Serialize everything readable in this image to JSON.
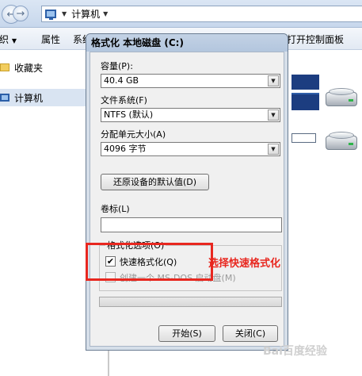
{
  "explorer": {
    "address_text": "计算机",
    "toolbar": {
      "organize_label": "织",
      "properties_label": "属性",
      "system_label": "系统",
      "control_panel_label": "打开控制面板"
    },
    "sidebar": {
      "items": [
        {
          "label": "收藏夹",
          "icon": "folder-star-icon"
        },
        {
          "label": "计算机",
          "icon": "computer-icon"
        }
      ]
    }
  },
  "dialog": {
    "title": "格式化 本地磁盘 (C:)",
    "capacity_label": "容量(P):",
    "capacity_value": "40.4 GB",
    "filesystem_label": "文件系统(F)",
    "filesystem_value": "NTFS (默认)",
    "allocation_label": "分配单元大小(A)",
    "allocation_value": "4096 字节",
    "restore_defaults_label": "还原设备的默认值(D)",
    "volume_label_label": "卷标(L)",
    "volume_label_value": "",
    "format_options_label": "格式化选项(O)",
    "quick_format_label": "快速格式化(Q)",
    "quick_format_checked": true,
    "msdos_label": "创建一个 MS-DOS 启动盘(M)",
    "msdos_checked": false,
    "progress": 0,
    "start_label": "开始(S)",
    "close_label": "关闭(C)"
  },
  "annotation": {
    "text": "选择快速格式化",
    "color": "#e8271f"
  },
  "watermark": "Bai百度经验"
}
